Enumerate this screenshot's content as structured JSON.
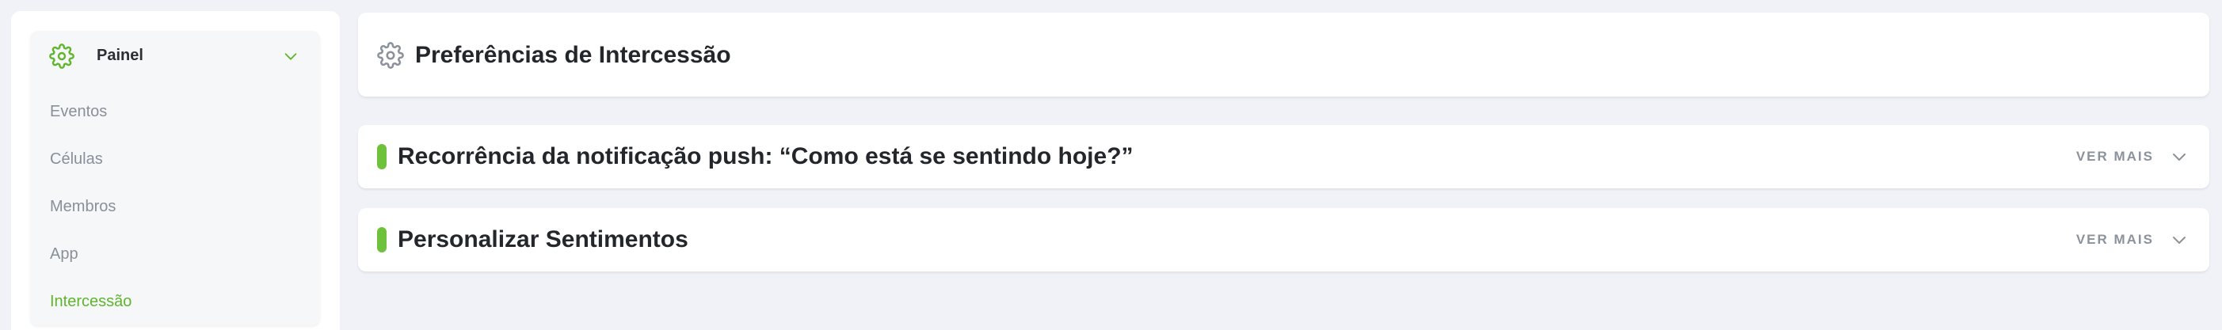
{
  "sidebar": {
    "header": {
      "label": "Painel",
      "icon": "gear-icon",
      "expand_icon": "chevron-down-icon"
    },
    "items": [
      {
        "label": "Eventos",
        "active": false
      },
      {
        "label": "Células",
        "active": false
      },
      {
        "label": "Membros",
        "active": false
      },
      {
        "label": "App",
        "active": false
      },
      {
        "label": "Intercessão",
        "active": true
      }
    ]
  },
  "main": {
    "page_title": "Preferências de Intercessão",
    "sections": [
      {
        "title": "Recorrência da notificação push: “Como está se sentindo hoje?”",
        "more_label": "VER MAIS"
      },
      {
        "title": "Personalizar Sentimentos",
        "more_label": "VER MAIS"
      }
    ]
  },
  "colors": {
    "accent": "#5fb52b",
    "section_bar": "#6ec13a",
    "background": "#f0f2f7",
    "muted_text": "#8a9099"
  }
}
